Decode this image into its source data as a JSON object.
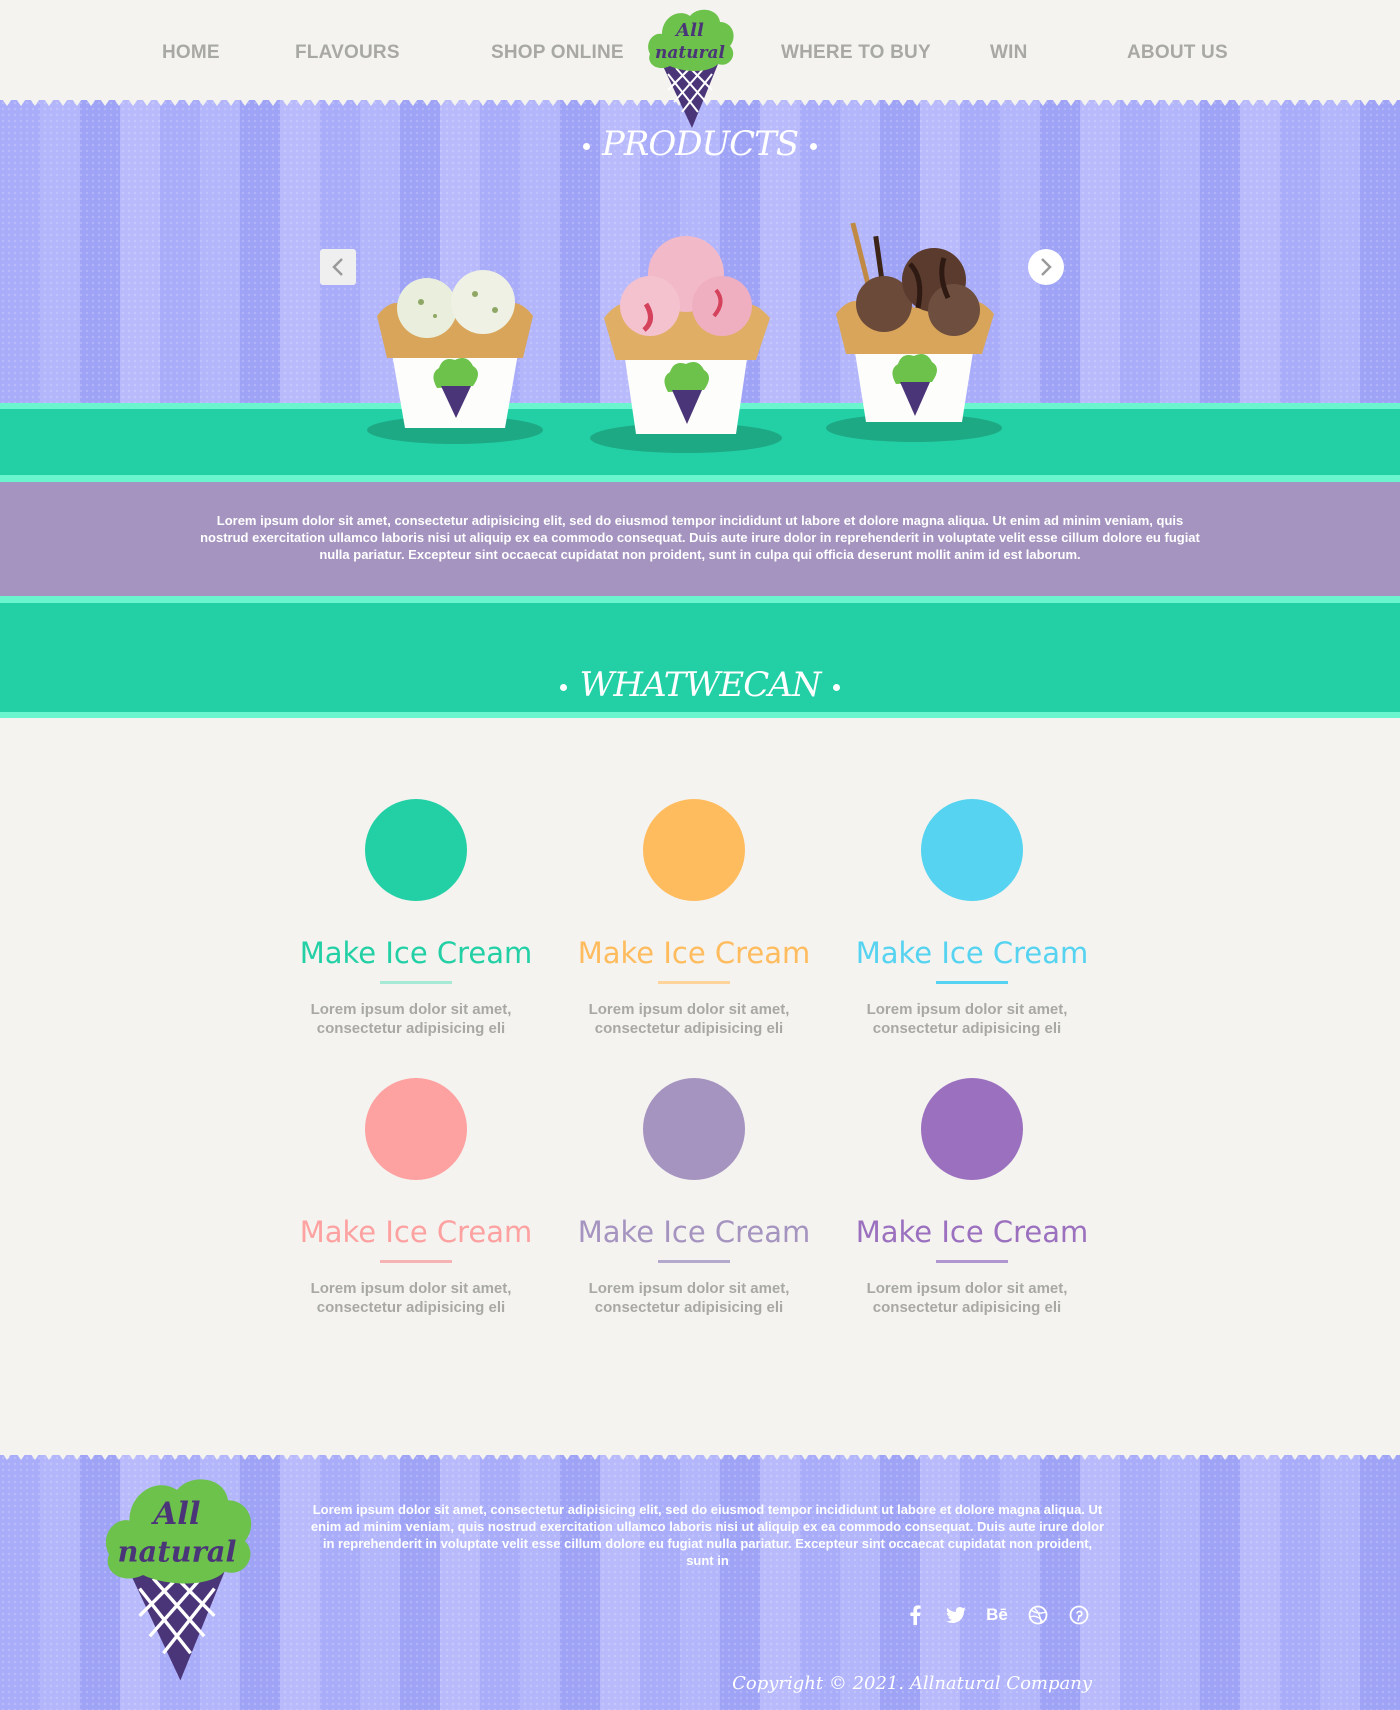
{
  "nav": {
    "items": [
      {
        "label": "HOME"
      },
      {
        "label": "FLAVOURS"
      },
      {
        "label": "SHOP ONLINE"
      },
      {
        "label": "WHERE TO BUY"
      },
      {
        "label": "WIN"
      },
      {
        "label": "ABOUT US"
      }
    ]
  },
  "brand": {
    "logo_text": "Allnatural",
    "logo_icon": "ice-cream-cone-logo"
  },
  "hero": {
    "title": "PRODUCTS",
    "prev_icon": "chevron-left-icon",
    "next_icon": "chevron-right-icon",
    "products": [
      {
        "name": "pistachio-ice-cream-cup"
      },
      {
        "name": "strawberry-ice-cream-cup"
      },
      {
        "name": "chocolate-ice-cream-cup"
      }
    ]
  },
  "intro": {
    "text": "Lorem ipsum dolor sit amet, consectetur adipisicing elit, sed do eiusmod tempor incididunt ut labore et dolore magna aliqua. Ut enim ad minim veniam, quis nostrud exercitation ullamco laboris nisi ut aliquip ex ea commodo consequat. Duis aute irure dolor in reprehenderit in voluptate velit esse cillum dolore eu fugiat nulla pariatur. Excepteur sint occaecat cupidatat non proident, sunt in culpa qui officia deserunt mollit anim id est laborum."
  },
  "features": {
    "title": "WHATWECAN",
    "items": [
      {
        "title": "Make Ice Cream",
        "text": "Lorem ipsum dolor sit amet, consectetur adipisicing eli",
        "color": "#23d0a5",
        "line": "#a6ead6"
      },
      {
        "title": "Make Ice Cream",
        "text": "Lorem ipsum dolor sit amet, consectetur adipisicing eli",
        "color": "#ffbc5e",
        "line": "#ffd49a"
      },
      {
        "title": "Make Ice Cream",
        "text": "Lorem ipsum dolor sit amet, consectetur adipisicing eli",
        "color": "#55d3f0",
        "line": "#55d3f0"
      },
      {
        "title": "Make Ice Cream",
        "text": "Lorem ipsum dolor sit amet, consectetur adipisicing eli",
        "color": "#fda1a1",
        "line": "#f6b3b3"
      },
      {
        "title": "Make Ice Cream",
        "text": "Lorem ipsum dolor sit amet, consectetur adipisicing eli",
        "color": "#a594c0",
        "line": "#b3a9cc"
      },
      {
        "title": "Make Ice Cream",
        "text": "Lorem ipsum dolor sit amet, consectetur adipisicing eli",
        "color": "#9b71bf",
        "line": "#b096d0"
      }
    ]
  },
  "footer": {
    "text": "Lorem ipsum dolor sit amet, consectetur adipisicing elit, sed do eiusmod tempor incididunt ut labore et dolore magna aliqua. Ut enim ad minim veniam, quis nostrud exercitation ullamco laboris nisi ut aliquip ex ea commodo consequat. Duis aute irure dolor in reprehenderit in voluptate velit esse cillum dolore eu fugiat nulla pariatur. Excepteur sint occaecat cupidatat non proident, sunt in",
    "social": [
      {
        "icon": "facebook-icon",
        "glyph": "f"
      },
      {
        "icon": "twitter-icon",
        "glyph": "🐦"
      },
      {
        "icon": "behance-icon",
        "glyph": "Bē"
      },
      {
        "icon": "dribbble-icon",
        "glyph": "◍"
      },
      {
        "icon": "pinterest-icon",
        "glyph": "℗"
      }
    ],
    "copyright": "Copyright © 2021. Allnatural Company"
  },
  "colors": {
    "background": "#f4f3ef",
    "nav_text": "#a8a8a4",
    "stripe_purple": "#a9acf9",
    "mint": "#23d0a5",
    "mint_light": "#6af5cf",
    "lavender": "#a594c0",
    "logo_green": "#6cc24a",
    "logo_purple": "#4b3579"
  }
}
